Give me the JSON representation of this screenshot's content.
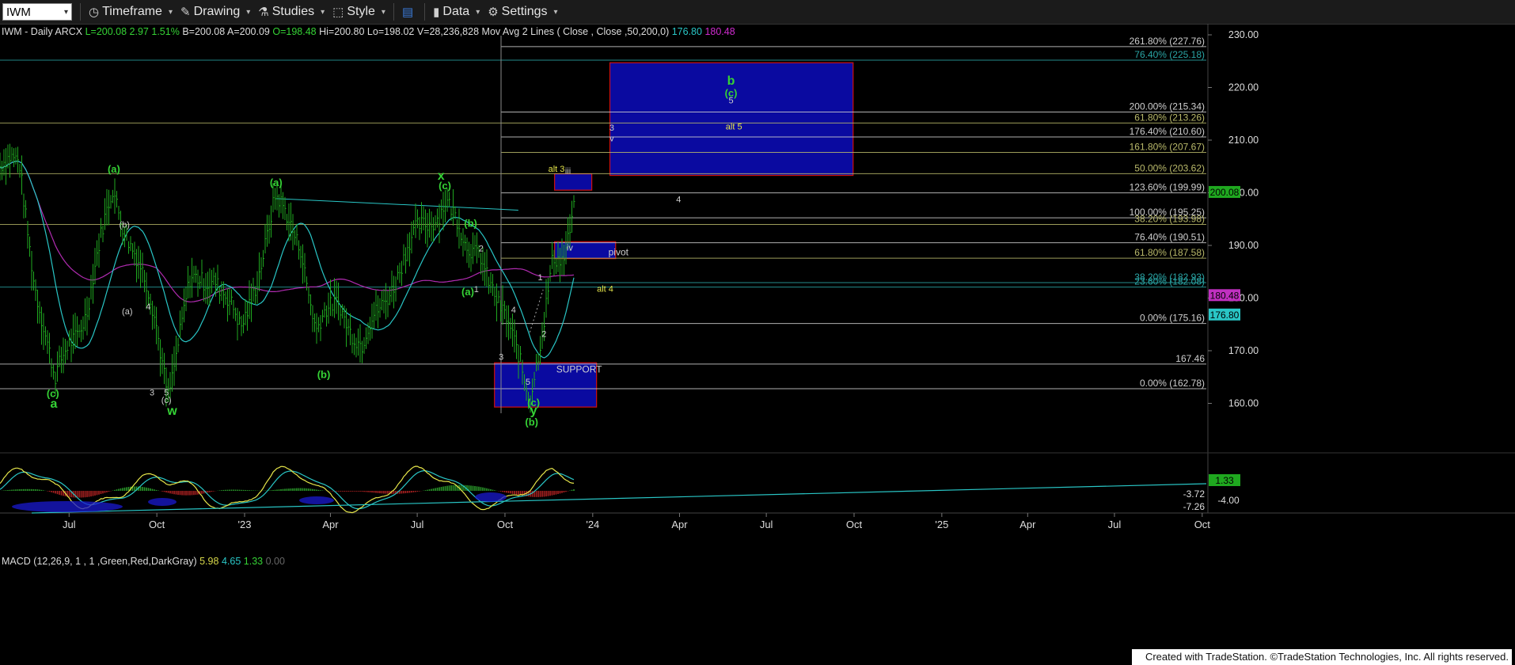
{
  "toolbar": {
    "symbol": "IWM",
    "timeframe": "Timeframe",
    "drawing": "Drawing",
    "studies": "Studies",
    "style": "Style",
    "data": "Data",
    "settings": "Settings"
  },
  "header": {
    "symbol_info": "IWM - Daily  ARCX",
    "last": "L=200.08",
    "change": "2.97",
    "pct": "1.51%",
    "bid": "B=200.08",
    "ask": "A=200.09",
    "open": "O=198.48",
    "high": "Hi=200.80",
    "low": "Lo=198.02",
    "volume": "V=28,236,828",
    "ma_label": "Mov Avg 2 Lines ( Close , Close ,50,200,0)",
    "ma_fast": "176.80",
    "ma_slow": "180.48"
  },
  "macd_header": {
    "label": "MACD (12,26,9, 1 , 1 ,Green,Red,DarkGray)",
    "macd": "5.98",
    "signal": "4.65",
    "hist": "1.33",
    "zero": "0.00"
  },
  "credit": "Created with TradeStation. ©TradeStation Technologies, Inc. All rights reserved.",
  "colors": {
    "background": "#000000",
    "price_bars": "#1fa81f",
    "ma_fast": "#29c6c6",
    "ma_slow": "#b02bb0",
    "fib_box": "#0a0aa0",
    "fib_box_border": "#d01010",
    "wave_label": "#35d235",
    "yellow_label": "#e6e64a"
  },
  "chart_data": [
    {
      "type": "line",
      "title": "IWM - Daily",
      "x_tick_labels": [
        "Jul",
        "Oct",
        "'23",
        "Apr",
        "Jul",
        "Oct",
        "'24",
        "Apr",
        "Jul",
        "Oct",
        "'25",
        "Apr",
        "Jul",
        "Oct"
      ],
      "y_tick_labels": [
        "230.00",
        "220.00",
        "210.00",
        "200.00",
        "190.00",
        "180.00",
        "170.00",
        "160.00"
      ],
      "ylim": [
        157.5,
        231.5
      ],
      "grid": false,
      "price_path": {
        "x": [
          "2022-05-10",
          "2022-05-25",
          "2022-06-16",
          "2022-07-01",
          "2022-07-20",
          "2022-08-16",
          "2022-09-05",
          "2022-09-30",
          "2022-10-13",
          "2022-11-05",
          "2022-12-01",
          "2022-12-28",
          "2023-02-02",
          "2023-03-01",
          "2023-03-17",
          "2023-04-10",
          "2023-05-04",
          "2023-06-01",
          "2023-07-01",
          "2023-07-31",
          "2023-08-20",
          "2023-09-05",
          "2023-09-25",
          "2023-10-16",
          "2023-10-27",
          "2023-11-10",
          "2023-11-20",
          "2023-12-01",
          "2023-12-14"
        ],
        "close": [
          205,
          185,
          163,
          172,
          178,
          201,
          190,
          175,
          163,
          182,
          185,
          173,
          198,
          191,
          173,
          180,
          170,
          182,
          192,
          199,
          189,
          190,
          177,
          170,
          162,
          173,
          186,
          188,
          200.08
        ]
      },
      "series": [
        {
          "name": "Mov Avg 50",
          "last": 176.8
        },
        {
          "name": "Mov Avg 200",
          "last": 180.48
        }
      ],
      "price_markers": [
        {
          "label": "200.08",
          "value": 200.08,
          "color": "#1fa81f"
        },
        {
          "label": "180.48",
          "value": 180.48,
          "color": "#c030c0"
        },
        {
          "label": "176.80",
          "value": 176.8,
          "color": "#29c6c6"
        }
      ],
      "fib_levels": [
        {
          "label": "261.80% (227.76)",
          "value": 227.76,
          "color": "#cfcfcf"
        },
        {
          "label": "76.40% (225.18)",
          "value": 225.18,
          "color": "#2aa6a6"
        },
        {
          "label": "200.00% (215.34)",
          "value": 215.34,
          "color": "#cfcfcf"
        },
        {
          "label": "61.80% (213.26)",
          "value": 213.26,
          "color": "#b9b96a"
        },
        {
          "label": "176.40% (210.60)",
          "value": 210.6,
          "color": "#cfcfcf"
        },
        {
          "label": "161.80% (207.67)",
          "value": 207.67,
          "color": "#b9b96a"
        },
        {
          "label": "50.00% (203.62)",
          "value": 203.62,
          "color": "#b9b96a"
        },
        {
          "label": "123.60% (199.99)",
          "value": 199.99,
          "color": "#cfcfcf"
        },
        {
          "label": "100.00% (195.25)",
          "value": 195.25,
          "color": "#cfcfcf"
        },
        {
          "label": "38.20% (193.98)",
          "value": 193.98,
          "color": "#b9b96a"
        },
        {
          "label": "76.40% (190.51)",
          "value": 190.51,
          "color": "#cfcfcf"
        },
        {
          "label": "61.80% (187.58)",
          "value": 187.58,
          "color": "#b9b96a"
        },
        {
          "label": "38.20% (182.93)",
          "value": 182.93,
          "color": "#2aa6a6"
        },
        {
          "label": "23.60% (182.08)",
          "value": 182.08,
          "color": "#2aa6a6"
        },
        {
          "label": "0.00% (175.16)",
          "value": 175.16,
          "color": "#cfcfcf"
        },
        {
          "label": "167.46",
          "value": 167.46,
          "color": "#cfcfcf"
        },
        {
          "label": "0.00% (162.78)",
          "value": 162.78,
          "color": "#cfcfcf"
        }
      ],
      "zones": [
        {
          "label": "",
          "x": [
            "2024-01-19",
            "2024-09-30"
          ],
          "y": [
            203.3,
            224.7
          ]
        },
        {
          "label": "",
          "x": [
            "2023-11-22",
            "2023-12-31"
          ],
          "y": [
            200.5,
            203.6
          ]
        },
        {
          "label": "pivot",
          "x": [
            "2023-11-22",
            "2024-01-25"
          ],
          "y": [
            187.5,
            190.7
          ]
        },
        {
          "label": "SUPPORT",
          "x": [
            "2023-09-20",
            "2024-01-05"
          ],
          "y": [
            159.3,
            167.7
          ]
        }
      ],
      "wave_labels": [
        {
          "text": "b",
          "x": "2024-05-25",
          "y": 220.5,
          "color": "#35d235"
        },
        {
          "text": "(c)",
          "x": "2024-05-25",
          "y": 218.3,
          "color": "#35d235"
        },
        {
          "text": "5",
          "x": "2024-05-25",
          "y": 217.0,
          "color": "#cfcfcf"
        },
        {
          "text": "alt 5",
          "x": "2024-05-28",
          "y": 212.0,
          "color": "#e6e64a"
        },
        {
          "text": "3",
          "x": "2024-01-21",
          "y": 211.8,
          "color": "#cfcfcf"
        },
        {
          "text": "v",
          "x": "2024-01-21",
          "y": 209.8,
          "color": "#cfcfcf"
        },
        {
          "text": "alt 3",
          "x": "2023-11-24",
          "y": 204.0,
          "color": "#e6e64a"
        },
        {
          "text": "iii",
          "x": "2023-12-06",
          "y": 203.6,
          "color": "#cfcfcf"
        },
        {
          "text": "4",
          "x": "2024-03-31",
          "y": 198.2,
          "color": "#cfcfcf"
        },
        {
          "text": "iv",
          "x": "2023-12-08",
          "y": 189.0,
          "color": "#cfcfcf"
        },
        {
          "text": "alt 4",
          "x": "2024-01-14",
          "y": 181.2,
          "color": "#e6e64a"
        },
        {
          "text": "(a)",
          "x": "2022-08-17",
          "y": 203.8,
          "color": "#35d235"
        },
        {
          "text": "(a)",
          "x": "2023-02-03",
          "y": 201.3,
          "color": "#35d235"
        },
        {
          "text": "x",
          "x": "2023-07-26",
          "y": 202.5,
          "color": "#35d235"
        },
        {
          "text": "(c)",
          "x": "2023-07-30",
          "y": 200.7,
          "color": "#35d235"
        },
        {
          "text": "(b)",
          "x": "2023-08-26",
          "y": 193.5,
          "color": "#35d235"
        },
        {
          "text": "2",
          "x": "2023-09-06",
          "y": 188.9,
          "color": "#cfcfcf"
        },
        {
          "text": "(a)",
          "x": "2023-08-23",
          "y": 180.5,
          "color": "#35d235"
        },
        {
          "text": "1",
          "x": "2023-09-01",
          "y": 181.1,
          "color": "#cfcfcf"
        },
        {
          "text": "1",
          "x": "2023-11-07",
          "y": 183.4,
          "color": "#cfcfcf"
        },
        {
          "text": "4",
          "x": "2023-10-10",
          "y": 177.2,
          "color": "#cfcfcf"
        },
        {
          "text": "2",
          "x": "2023-11-11",
          "y": 172.6,
          "color": "#cfcfcf"
        },
        {
          "text": "3",
          "x": "2023-09-27",
          "y": 168.3,
          "color": "#cfcfcf"
        },
        {
          "text": "5",
          "x": "2023-10-25",
          "y": 163.5,
          "color": "#cfcfcf"
        },
        {
          "text": "(c)",
          "x": "2023-10-31",
          "y": 159.5,
          "color": "#35d235"
        },
        {
          "text": "y",
          "x": "2023-10-31",
          "y": 157.9,
          "color": "#35d235"
        },
        {
          "text": "(b)",
          "x": "2023-10-29",
          "y": 155.8,
          "color": "#35d235"
        },
        {
          "text": "(b)",
          "x": "2023-03-25",
          "y": 164.8,
          "color": "#35d235"
        },
        {
          "text": "(b)",
          "x": "2022-08-28",
          "y": 193.4,
          "color": "#cfcfcf"
        },
        {
          "text": "(a)",
          "x": "2022-08-31",
          "y": 176.9,
          "color": "#cfcfcf"
        },
        {
          "text": "4",
          "x": "2022-09-22",
          "y": 177.8,
          "color": "#cfcfcf"
        },
        {
          "text": "3",
          "x": "2022-09-26",
          "y": 161.5,
          "color": "#cfcfcf"
        },
        {
          "text": "5",
          "x": "2022-10-11",
          "y": 161.5,
          "color": "#cfcfcf"
        },
        {
          "text": "(c)",
          "x": "2022-10-11",
          "y": 160.1,
          "color": "#cfcfcf"
        },
        {
          "text": "w",
          "x": "2022-10-17",
          "y": 157.8,
          "color": "#35d235"
        },
        {
          "text": "(c)",
          "x": "2022-06-14",
          "y": 161.2,
          "color": "#35d235"
        },
        {
          "text": "a",
          "x": "2022-06-15",
          "y": 159.2,
          "color": "#35d235"
        }
      ]
    },
    {
      "type": "line",
      "title": "MACD (12,26,9, 1 , 1 ,Green,Red,DarkGray)",
      "y_tick_labels": [
        "1.33",
        "-3.72",
        "-4.00",
        "-7.26"
      ],
      "series": [
        {
          "name": "MACD",
          "last": 5.98
        },
        {
          "name": "Signal",
          "last": 4.65
        },
        {
          "name": "Histogram",
          "last": 1.33
        }
      ]
    }
  ]
}
